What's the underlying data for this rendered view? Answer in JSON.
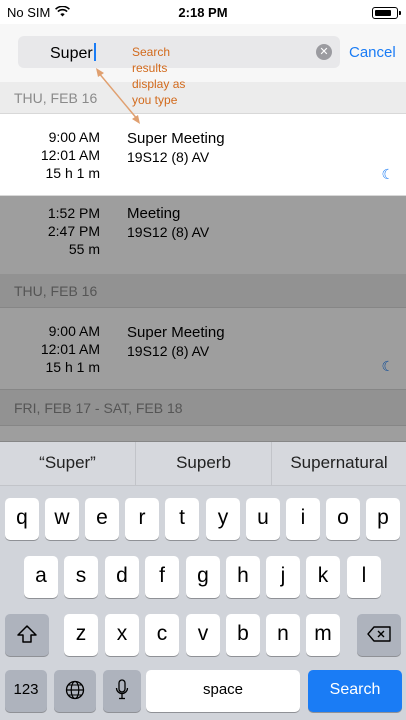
{
  "status_bar": {
    "carrier": "No SIM",
    "time": "2:18 PM"
  },
  "search": {
    "value": "Super",
    "cancel_label": "Cancel"
  },
  "annotation": "Search results display as you type",
  "sections": [
    {
      "header": "THU, FEB 16"
    },
    {
      "header": "THU, FEB 16"
    },
    {
      "header": "FRI, FEB 17  -  SAT, FEB 18"
    }
  ],
  "events": [
    {
      "start": "9:00 AM",
      "end": "12:01 AM",
      "duration": "15 h  1 m",
      "title": "Super Meeting",
      "location": "19S12 (8) AV",
      "icon": "moon-icon"
    },
    {
      "start": "1:52 PM",
      "end": "2:47 PM",
      "duration": "55 m",
      "title": "Meeting",
      "location": "19S12 (8) AV"
    },
    {
      "start": "9:00 AM",
      "end": "12:01 AM",
      "duration": "15 h  1 m",
      "title": "Super Meeting",
      "location": "19S12 (8) AV",
      "icon": "moon-icon"
    }
  ],
  "keyboard": {
    "suggestions": [
      "“Super”",
      "Superb",
      "Supernatural"
    ],
    "row1": [
      "q",
      "w",
      "e",
      "r",
      "t",
      "y",
      "u",
      "i",
      "o",
      "p"
    ],
    "row2": [
      "a",
      "s",
      "d",
      "f",
      "g",
      "h",
      "j",
      "k",
      "l"
    ],
    "row3": [
      "z",
      "x",
      "c",
      "v",
      "b",
      "n",
      "m"
    ],
    "numbers_label": "123",
    "space_label": "space",
    "search_label": "Search"
  }
}
